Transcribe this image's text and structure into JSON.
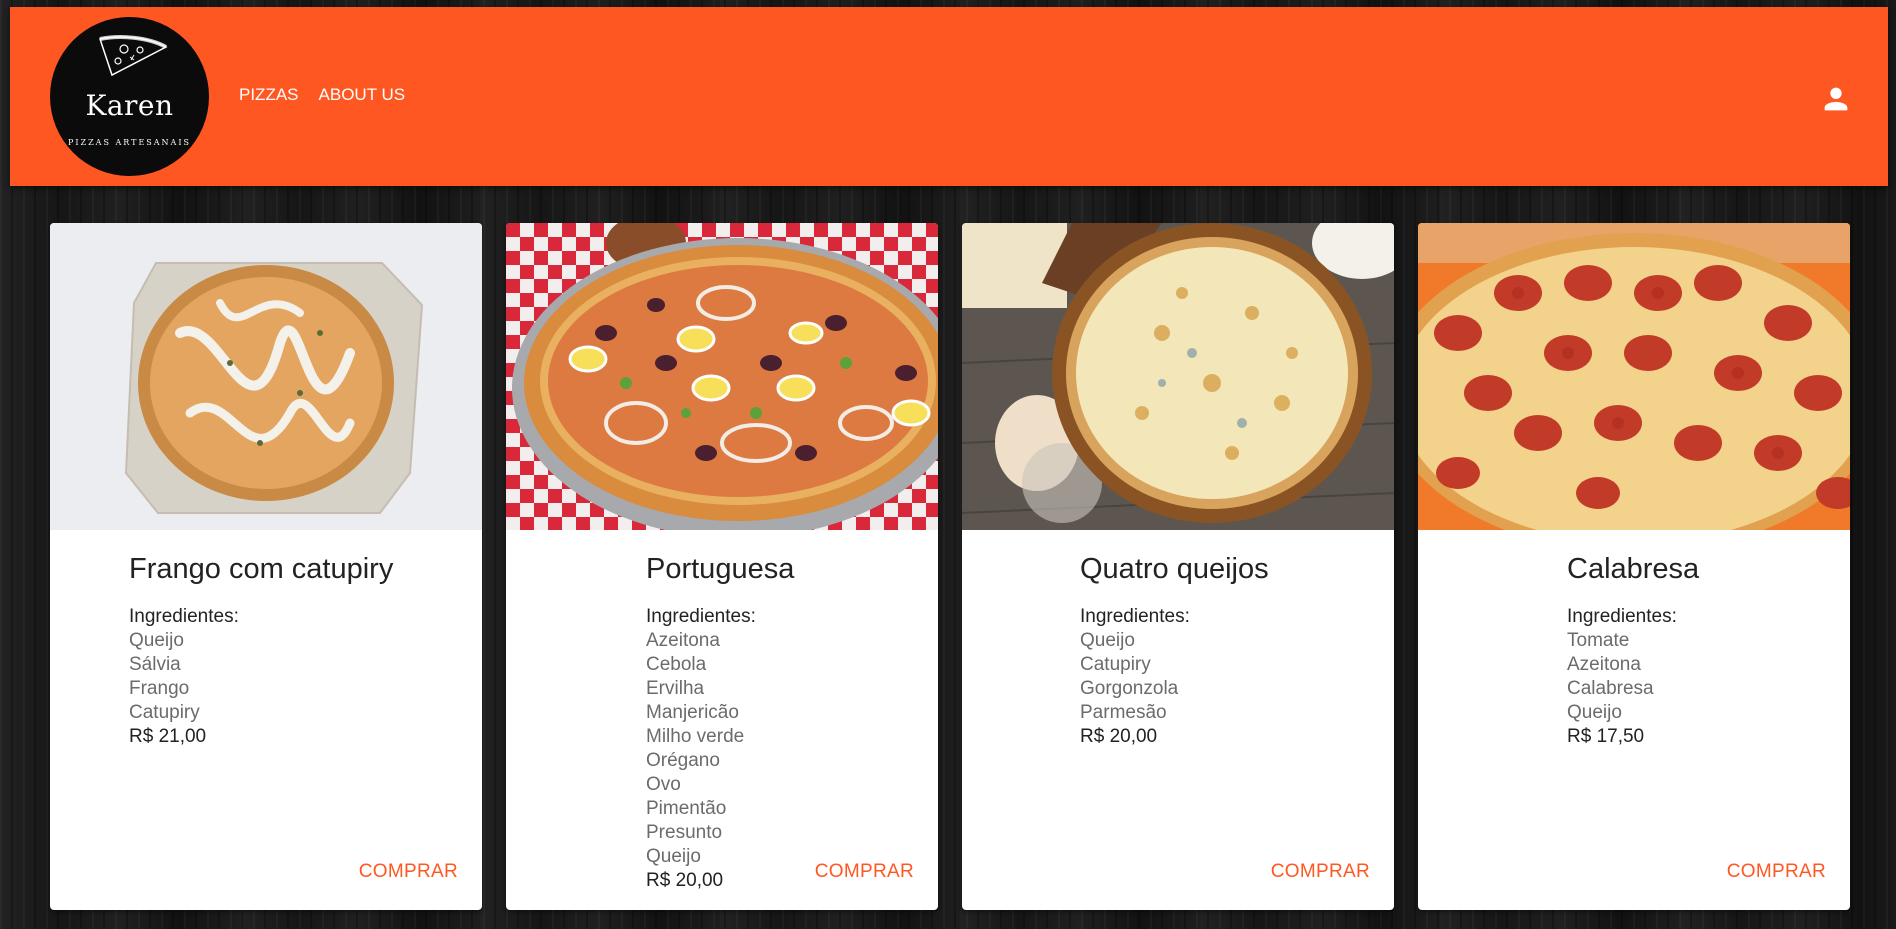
{
  "header": {
    "logo": {
      "name": "Karen",
      "subtitle": "PIZZAS ARTESANAIS",
      "icon": "pizza-slice-icon"
    },
    "nav": [
      {
        "label": "PIZZAS"
      },
      {
        "label": "ABOUT US"
      }
    ],
    "user_icon": "person-icon"
  },
  "colors": {
    "accent": "#ff5722",
    "card_bg": "#ffffff",
    "page_bg": "#1b1b1b"
  },
  "ingredients_label": "Ingredientes:",
  "buy_label": "COMPRAR",
  "pizzas": [
    {
      "name": "Frango com catupiry",
      "image": "pizza-frango-catupiry-photo",
      "ingredients": [
        "Queijo",
        "Sálvia",
        "Frango",
        "Catupiry"
      ],
      "price": "R$ 21,00"
    },
    {
      "name": "Portuguesa",
      "image": "pizza-portuguesa-photo",
      "ingredients": [
        "Azeitona",
        "Cebola",
        "Ervilha",
        "Manjericão",
        "Milho verde",
        "Orégano",
        "Ovo",
        "Pimentão",
        "Presunto",
        "Queijo"
      ],
      "price": "R$ 20,00"
    },
    {
      "name": "Quatro queijos",
      "image": "pizza-quatro-queijos-photo",
      "ingredients": [
        "Queijo",
        "Catupiry",
        "Gorgonzola",
        "Parmesão"
      ],
      "price": "R$ 20,00"
    },
    {
      "name": "Calabresa",
      "image": "pizza-calabresa-photo",
      "ingredients": [
        "Tomate",
        "Azeitona",
        "Calabresa",
        "Queijo"
      ],
      "price": "R$ 17,50"
    }
  ]
}
